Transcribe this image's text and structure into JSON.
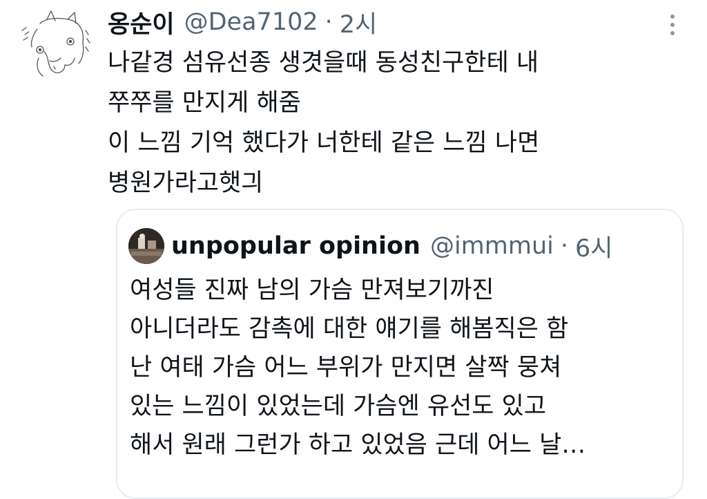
{
  "tweet": {
    "name": "옹순이",
    "handle": "@Dea7102",
    "separator": "·",
    "time": "2시",
    "lines": [
      "나같경 섬유선종 생겻을때 동성친구한테 내",
      "쭈쭈를 만지게 해줌",
      "이 느낌 기억 했다가 너한테 같은 느낌 나면",
      "병원가라고햇긔"
    ],
    "avatar_icon": "alpaca-doodle-avatar",
    "more_icon": "more-vertical-icon"
  },
  "quote": {
    "name": "unpopular opinion",
    "handle": "@immmui",
    "separator": "·",
    "time": "6시",
    "lines": [
      "여성들 진짜 남의 가슴 만져보기까진",
      "아니더라도 감촉에 대한 얘기를 해봄직은 함",
      "난 여태 가슴 어느 부위가 만지면 살짝 뭉쳐",
      "있는 느낌이 있었는데 가슴엔 유선도 있고",
      "해서 원래 그런가 하고 있었음 근데 어느 날…"
    ]
  },
  "colors": {
    "text": "#0f1419",
    "secondary": "#536471",
    "border": "#e6ecf0"
  }
}
